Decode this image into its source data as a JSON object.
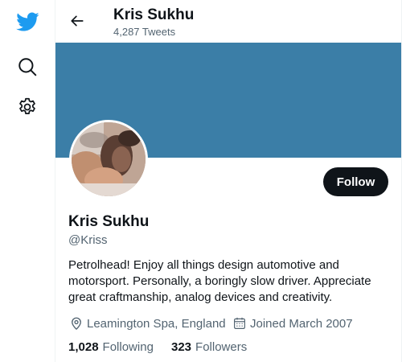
{
  "colors": {
    "brand": "#1d9bf0",
    "banner": "#3b7ea7",
    "text_primary": "#0f1419",
    "text_secondary": "#536471",
    "follow_button_bg": "#0f1419",
    "follow_button_text": "#ffffff"
  },
  "nav": {
    "items": [
      {
        "icon": "twitter-bird-icon"
      },
      {
        "icon": "search-icon"
      },
      {
        "icon": "gear-icon"
      }
    ]
  },
  "header": {
    "back_icon": "back-arrow-icon",
    "title": "Kris Sukhu",
    "subtitle": "4,287 Tweets"
  },
  "profile": {
    "name": "Kris Sukhu",
    "handle": "@Kriss",
    "follow_label": "Follow",
    "bio": "Petrolhead! Enjoy all things design automotive and motorsport. Personally, a boringly slow driver. Appreciate great craftmanship, analog devices and creativity.",
    "location": "Leamington Spa, England",
    "location_icon": "location-pin-icon",
    "joined": "Joined March 2007",
    "joined_icon": "calendar-icon",
    "following_count": "1,028",
    "following_label": "Following",
    "followers_count": "323",
    "followers_label": "Followers"
  }
}
